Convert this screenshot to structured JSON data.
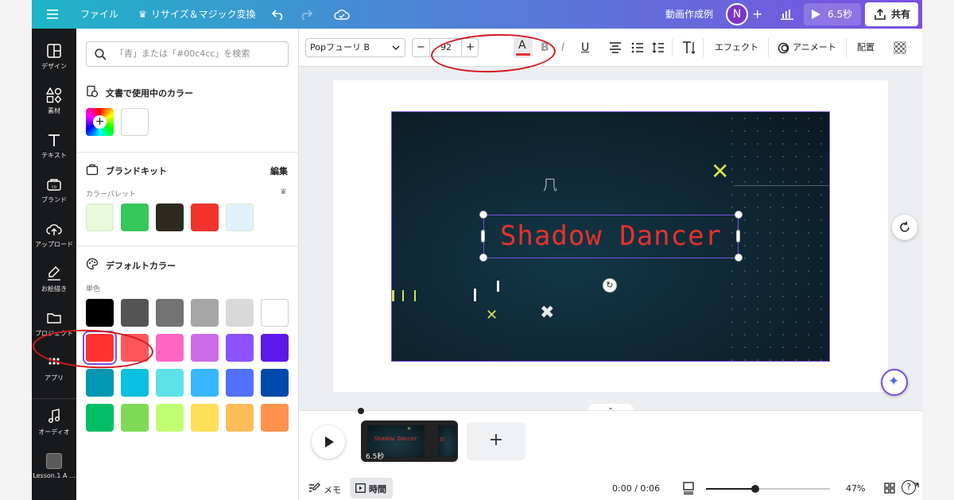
{
  "topbar": {
    "file_label": "ファイル",
    "resize_label": "リサイズ＆マジック変換",
    "project_title": "動画作成例",
    "avatar_initial": "N",
    "duration_label": "6.5秒",
    "share_label": "共有"
  },
  "rail": {
    "items": [
      {
        "label": "デザイン",
        "icon": "layout-icon"
      },
      {
        "label": "素材",
        "icon": "shapes-icon"
      },
      {
        "label": "テキスト",
        "icon": "text-icon"
      },
      {
        "label": "ブランド",
        "icon": "brand-icon"
      },
      {
        "label": "アップロード",
        "icon": "upload-cloud-icon"
      },
      {
        "label": "お絵描き",
        "icon": "draw-icon"
      },
      {
        "label": "プロジェクト",
        "icon": "folder-icon"
      },
      {
        "label": "アプリ",
        "icon": "apps-grid-icon"
      },
      {
        "label": "オーディオ",
        "icon": "music-icon"
      },
      {
        "label": "Lesson.1 A ...",
        "icon": "lesson-thumbnail-icon"
      }
    ]
  },
  "panel": {
    "search_placeholder": "「青」または「#00c4cc」を検索",
    "doc_colors_title": "文書で使用中のカラー",
    "brand_kit_title": "ブランドキット",
    "brand_edit": "編集",
    "palette_label": "カラーパレット",
    "brand_colors": [
      "#e8f8d8",
      "#35c75a",
      "#2b2a1e",
      "#f0342d",
      "#e0f1fb"
    ],
    "default_colors_title": "デフォルトカラー",
    "solid_label": "単色",
    "default_colors": [
      [
        "#000000",
        "#545454",
        "#737373",
        "#a6a6a6",
        "#d9d9d9",
        "#ffffff"
      ],
      [
        "#ff3131",
        "#ff5757",
        "#ff66c4",
        "#cb6ce6",
        "#8c52ff",
        "#5e17eb"
      ],
      [
        "#0097b2",
        "#0cc0df",
        "#5ce1e6",
        "#38b6ff",
        "#5271ff",
        "#004aad"
      ],
      [
        "#00bf63",
        "#7ed957",
        "#c1ff72",
        "#ffde59",
        "#ffbd59",
        "#ff914d"
      ]
    ]
  },
  "toolbar": {
    "font_name": "Popフューリ B",
    "font_size": "92",
    "effect_label": "エフェクト",
    "animate_label": "アニメート",
    "position_label": "配置"
  },
  "canvas": {
    "text": "Shadow Dancer",
    "text_color": "#e8312c"
  },
  "timeline": {
    "clip_duration": "6.5秒",
    "clip_text": "Shadow Dancer",
    "memo_label": "メモ",
    "time_label": "時間",
    "time_display": "0:00 / 0:06",
    "zoom_label": "47%",
    "zoom_level_percent": 40
  },
  "colors": {
    "annotation_red": "#d6181f",
    "accent_purple": "#7b4fe0"
  }
}
